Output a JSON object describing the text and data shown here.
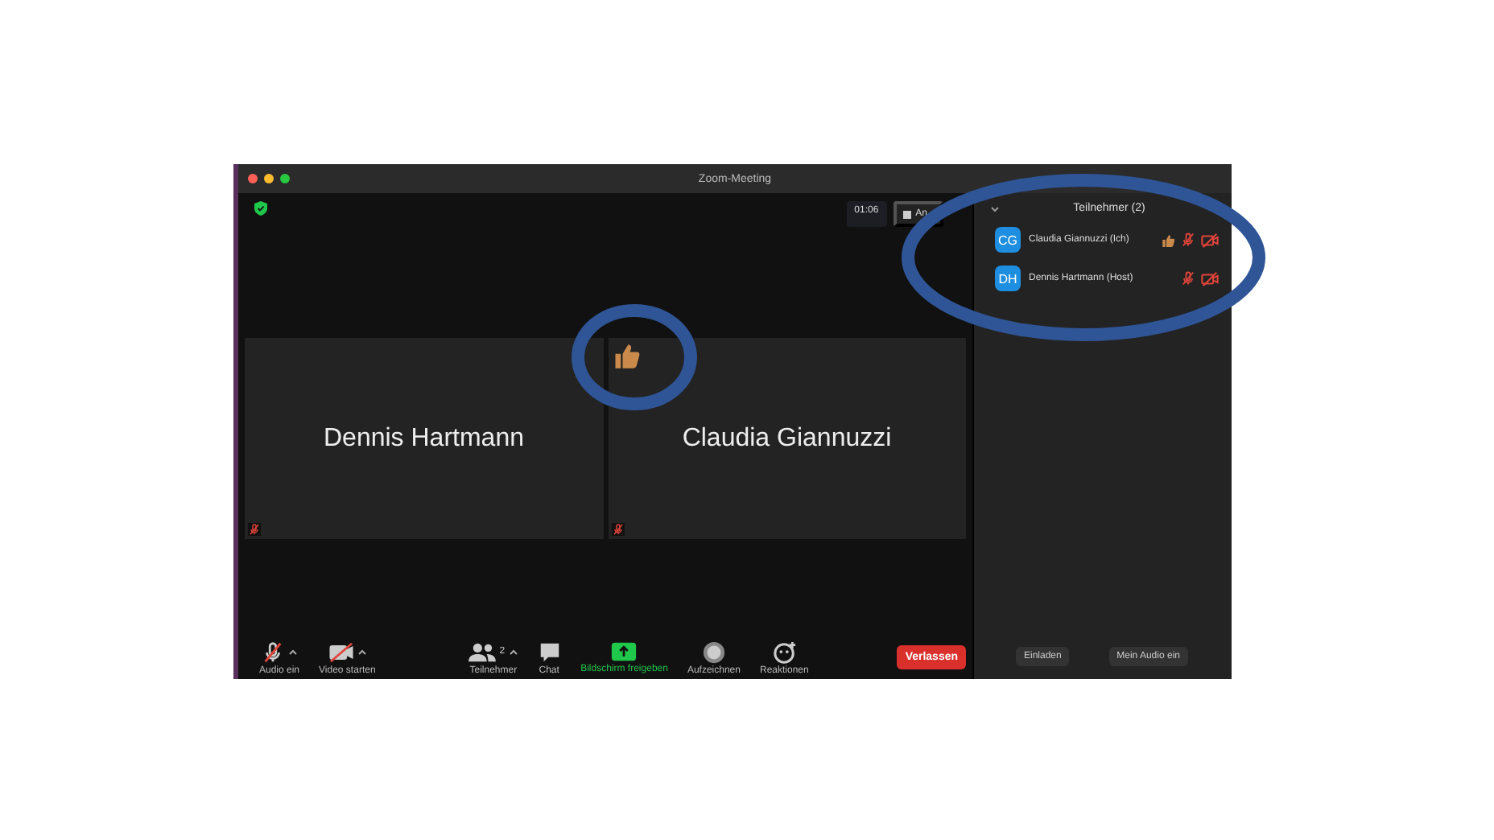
{
  "window": {
    "title": "Zoom-Meeting"
  },
  "header": {
    "timer": "01:06",
    "view_button": "An"
  },
  "tiles": [
    {
      "name": "Dennis Hartmann",
      "muted": true,
      "thumbs_up": false
    },
    {
      "name": "Claudia Giannuzzi",
      "muted": true,
      "thumbs_up": true
    }
  ],
  "toolbar": {
    "left": [
      {
        "label": "Audio ein",
        "kind": "mic_off",
        "caret": true,
        "highlighted": false
      },
      {
        "label": "Video starten",
        "kind": "video_off",
        "caret": true,
        "highlighted": false
      }
    ],
    "center": [
      {
        "label": "Teilnehmer",
        "kind": "participants",
        "count": "2",
        "caret": true,
        "highlighted": false
      },
      {
        "label": "Chat",
        "kind": "chat",
        "caret": false,
        "highlighted": false
      },
      {
        "label": "Bildschirm freigeben",
        "kind": "share",
        "caret": false,
        "highlighted": true
      },
      {
        "label": "Aufzeichnen",
        "kind": "record",
        "caret": false,
        "highlighted": false
      },
      {
        "label": "Reaktionen",
        "kind": "reactions",
        "caret": false,
        "highlighted": false
      }
    ],
    "leave_button": "Verlassen"
  },
  "participants_panel": {
    "title": "Teilnehmer (2)",
    "participants": [
      {
        "initials": "CG",
        "name": "Claudia Giannuzzi (Ich)",
        "thumbs_up": true,
        "audio_muted": true,
        "video_off": true
      },
      {
        "initials": "DH",
        "name": "Dennis Hartmann (Host)",
        "thumbs_up": false,
        "audio_muted": true,
        "video_off": true
      }
    ],
    "buttons": [
      "Einladen",
      "Mein Audio ein"
    ]
  }
}
